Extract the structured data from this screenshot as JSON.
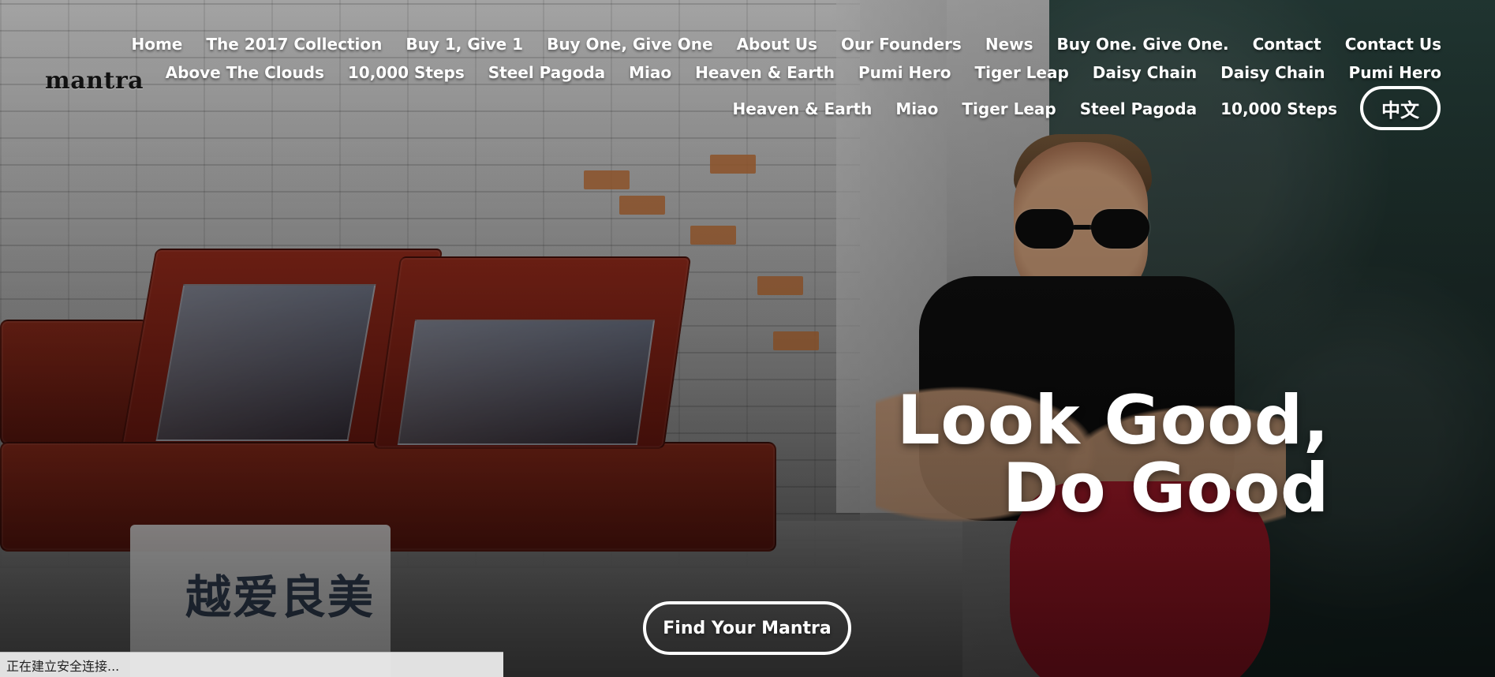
{
  "header": {
    "logo_text": "mantra",
    "nav": {
      "row1": [
        "Home",
        "The 2017 Collection",
        "Buy 1, Give 1",
        "Buy One, Give One",
        "About Us",
        "Our Founders",
        "News",
        "Buy One. Give One.",
        "Contact",
        "Contact Us"
      ],
      "row2": [
        "Above The Clouds",
        "10,000 Steps",
        "Steel Pagoda",
        "Miao",
        "Heaven & Earth",
        "Pumi Hero",
        "Tiger Leap",
        "Daisy Chain",
        "Daisy Chain",
        "Pumi Hero"
      ],
      "row3": [
        "Heaven & Earth",
        "Miao",
        "Tiger Leap",
        "Steel Pagoda",
        "10,000 Steps"
      ]
    },
    "language_button": "中文"
  },
  "hero": {
    "headline_line1": "Look Good,",
    "headline_line2": "Do Good",
    "cta_label": "Find Your Mantra"
  },
  "status": {
    "text": "正在建立安全连接..."
  }
}
